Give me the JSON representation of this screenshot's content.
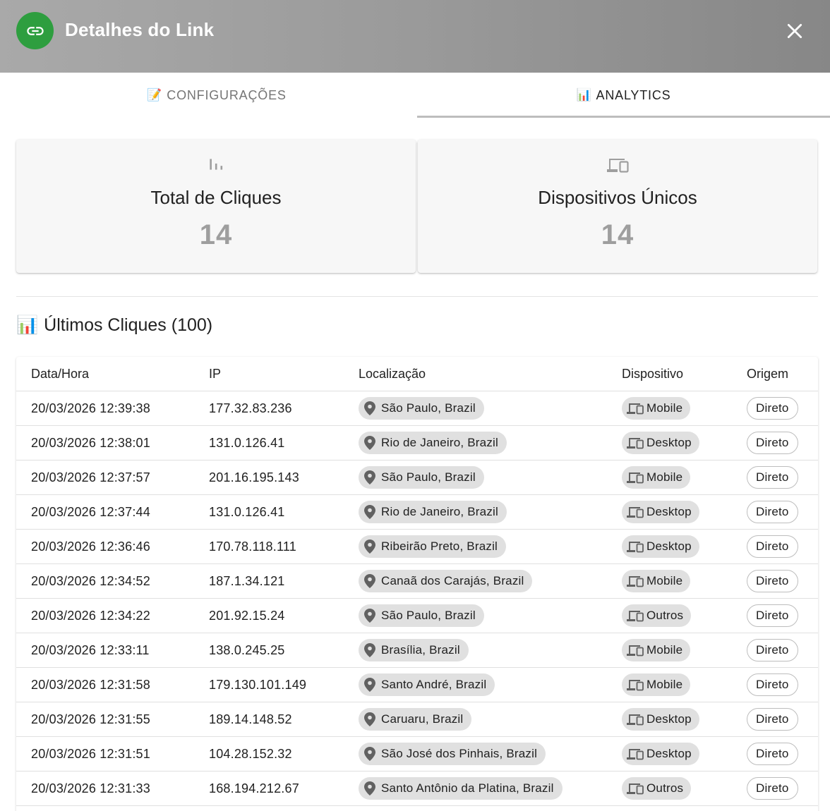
{
  "header": {
    "title": "Detalhes do Link",
    "logo_icon": "link-icon",
    "close_icon": "close-icon",
    "accent": "#2e9e3f"
  },
  "tabs": [
    {
      "emoji": "📝",
      "label": "CONFIGURAÇÕES",
      "active": false
    },
    {
      "emoji": "📊",
      "label": "ANALYTICS",
      "active": true
    }
  ],
  "stats": [
    {
      "icon": "bar-chart-icon",
      "label": "Total de Cliques",
      "value": "14"
    },
    {
      "icon": "devices-icon",
      "label": "Dispositivos Únicos",
      "value": "14"
    }
  ],
  "recent": {
    "emoji": "📊",
    "title": "Últimos Cliques (100)"
  },
  "table": {
    "headers": [
      "Data/Hora",
      "IP",
      "Localização",
      "Dispositivo",
      "Origem"
    ],
    "rows": [
      {
        "datetime": "20/03/2026 12:39:38",
        "ip": "177.32.83.236",
        "location": "São Paulo, Brazil",
        "device": "Mobile",
        "origin": "Direto"
      },
      {
        "datetime": "20/03/2026 12:38:01",
        "ip": "131.0.126.41",
        "location": "Rio de Janeiro, Brazil",
        "device": "Desktop",
        "origin": "Direto"
      },
      {
        "datetime": "20/03/2026 12:37:57",
        "ip": "201.16.195.143",
        "location": "São Paulo, Brazil",
        "device": "Mobile",
        "origin": "Direto"
      },
      {
        "datetime": "20/03/2026 12:37:44",
        "ip": "131.0.126.41",
        "location": "Rio de Janeiro, Brazil",
        "device": "Desktop",
        "origin": "Direto"
      },
      {
        "datetime": "20/03/2026 12:36:46",
        "ip": "170.78.118.111",
        "location": "Ribeirão Preto, Brazil",
        "device": "Desktop",
        "origin": "Direto"
      },
      {
        "datetime": "20/03/2026 12:34:52",
        "ip": "187.1.34.121",
        "location": "Canaã dos Carajás, Brazil",
        "device": "Mobile",
        "origin": "Direto"
      },
      {
        "datetime": "20/03/2026 12:34:22",
        "ip": "201.92.15.24",
        "location": "São Paulo, Brazil",
        "device": "Outros",
        "origin": "Direto"
      },
      {
        "datetime": "20/03/2026 12:33:11",
        "ip": "138.0.245.25",
        "location": "Brasília, Brazil",
        "device": "Mobile",
        "origin": "Direto"
      },
      {
        "datetime": "20/03/2026 12:31:58",
        "ip": "179.130.101.149",
        "location": "Santo André, Brazil",
        "device": "Mobile",
        "origin": "Direto"
      },
      {
        "datetime": "20/03/2026 12:31:55",
        "ip": "189.14.148.52",
        "location": "Caruaru, Brazil",
        "device": "Desktop",
        "origin": "Direto"
      },
      {
        "datetime": "20/03/2026 12:31:51",
        "ip": "104.28.152.32",
        "location": "São José dos Pinhais, Brazil",
        "device": "Desktop",
        "origin": "Direto"
      },
      {
        "datetime": "20/03/2026 12:31:33",
        "ip": "168.194.212.67",
        "location": "Santo Antônio da Platina, Brazil",
        "device": "Outros",
        "origin": "Direto"
      }
    ]
  }
}
